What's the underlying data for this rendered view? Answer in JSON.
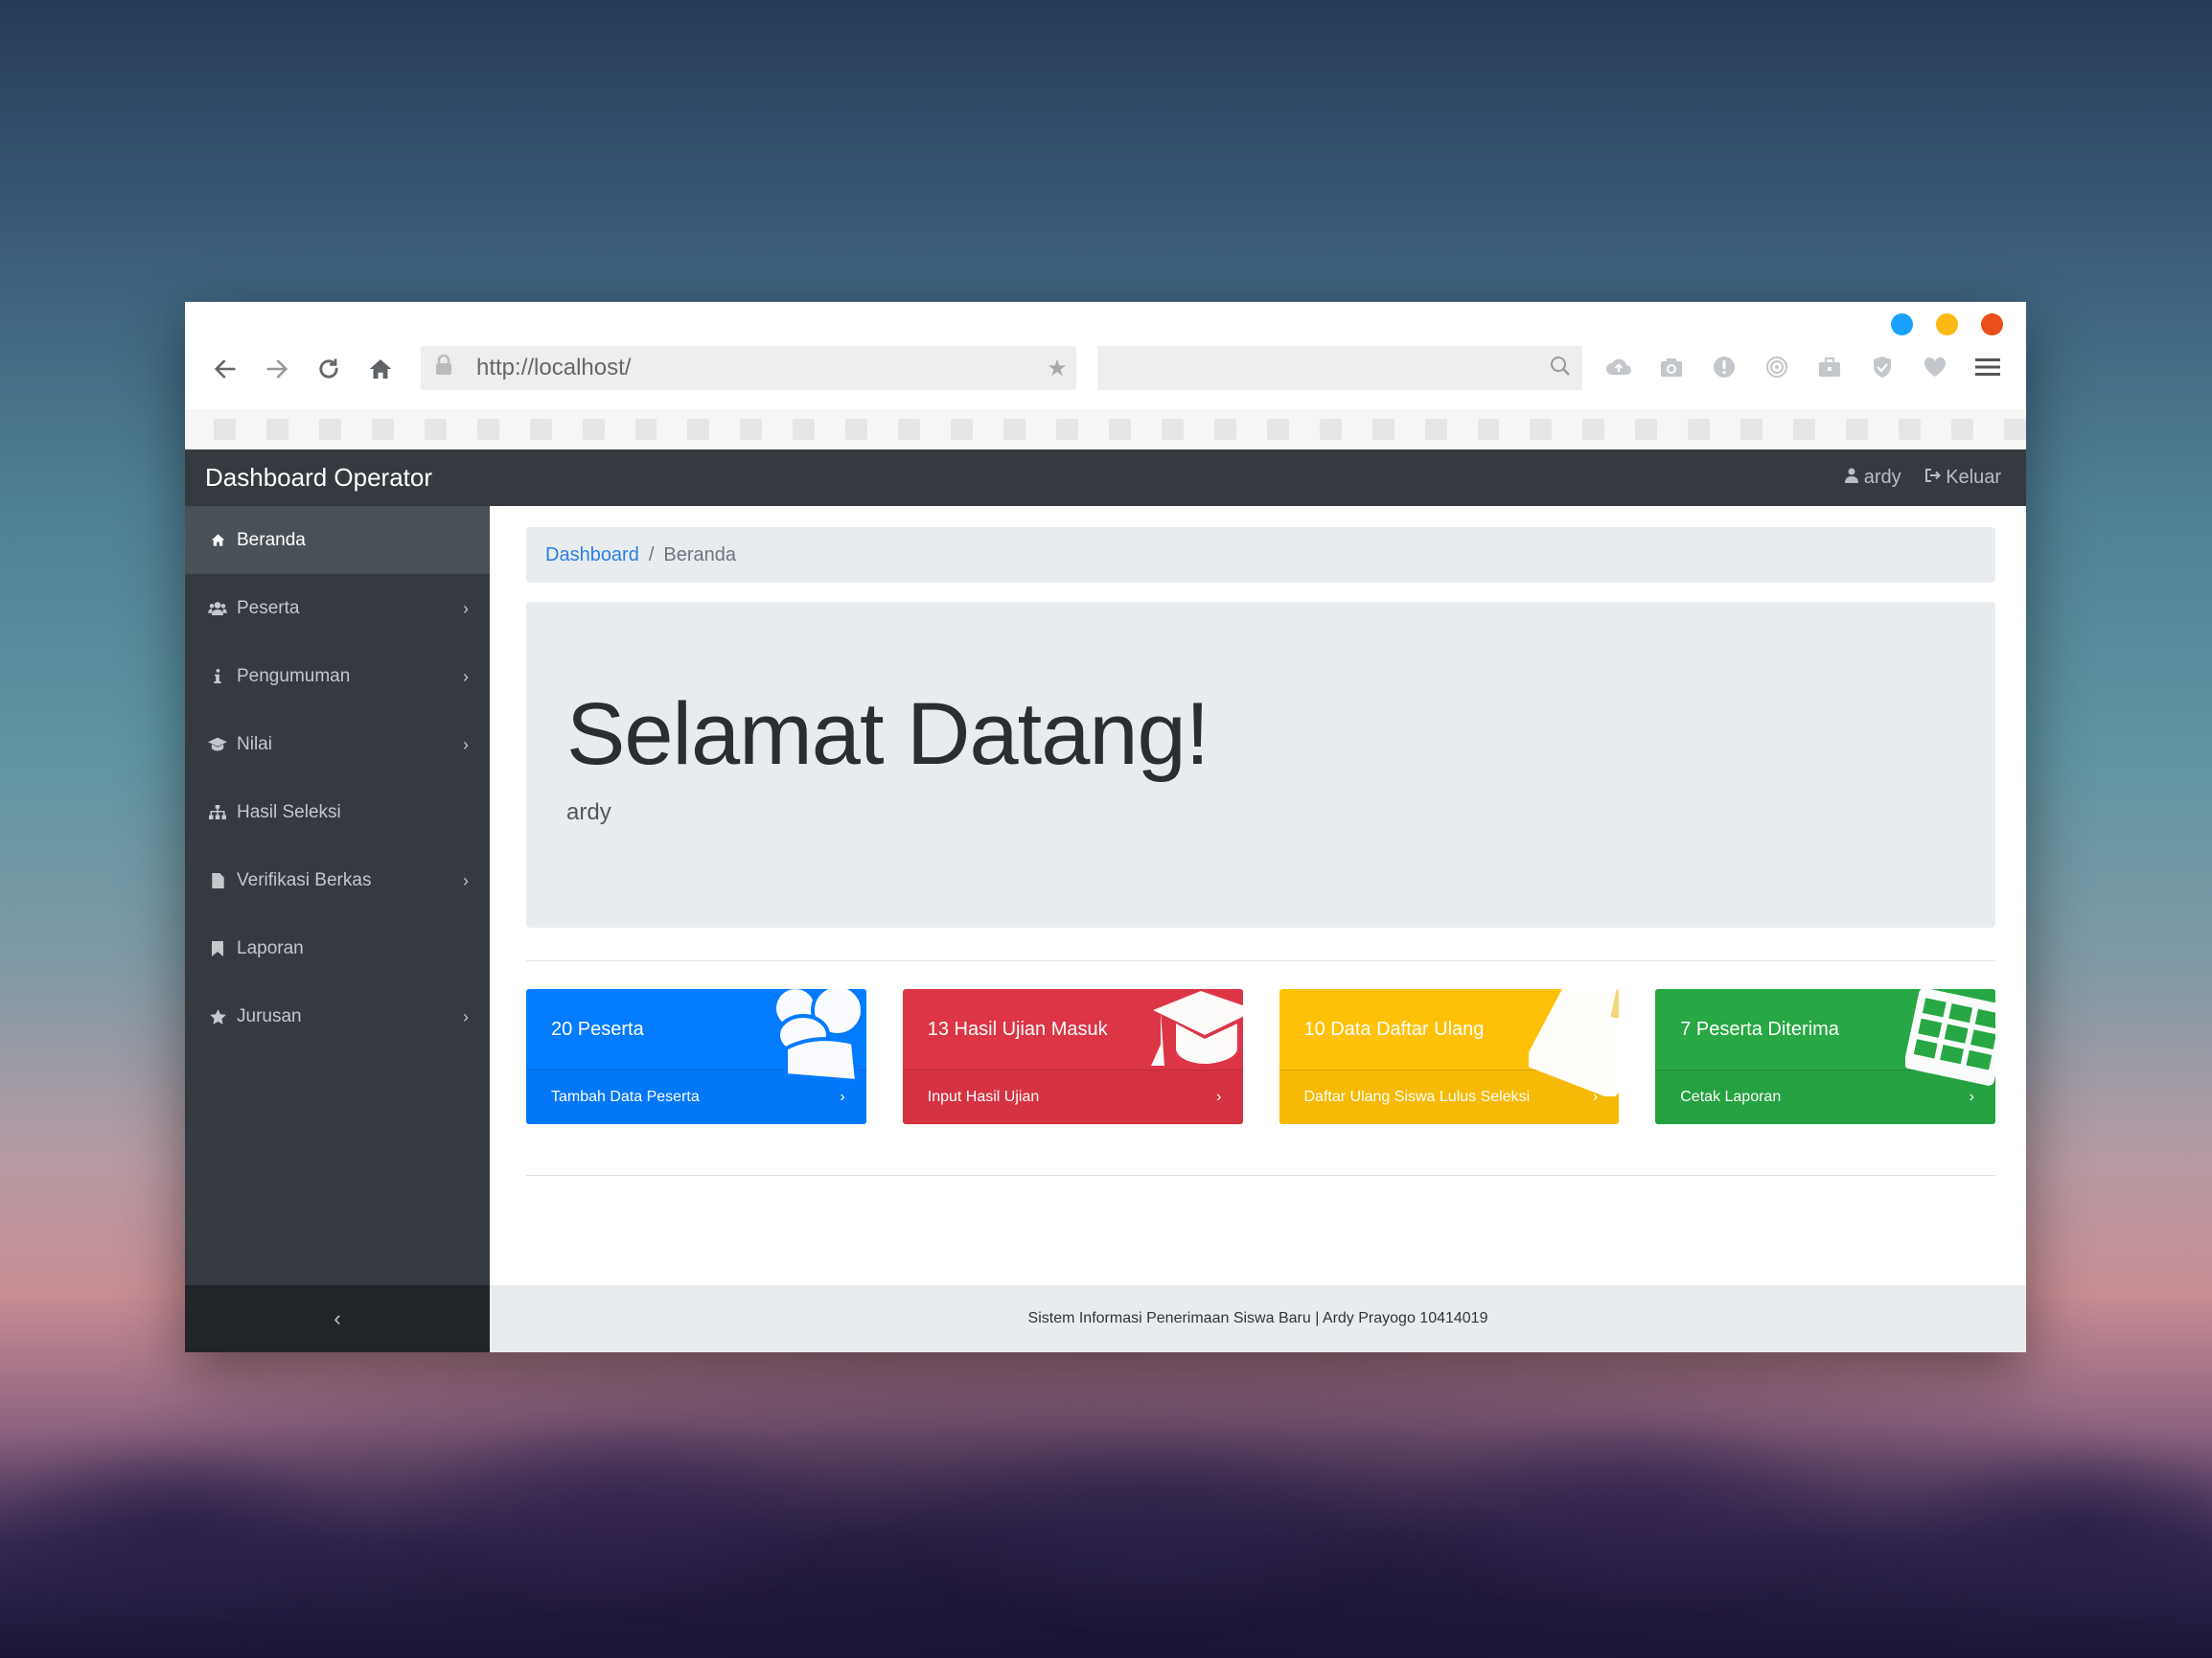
{
  "browser": {
    "url": "http://localhost/",
    "search_placeholder": "",
    "window_dots": [
      "#18a1ff",
      "#fdb813",
      "#ea4e1d"
    ],
    "toolbar_icons": [
      "cloud-upload-icon",
      "camera-icon",
      "alert-icon",
      "fingerprint-icon",
      "briefcase-icon",
      "shield-icon",
      "heart-icon"
    ]
  },
  "app": {
    "brand": "Dashboard Operator",
    "user": "ardy",
    "logout": "Keluar"
  },
  "sidebar": {
    "items": [
      {
        "label": "Beranda",
        "icon": "home-icon",
        "active": true,
        "submenu": false
      },
      {
        "label": "Peserta",
        "icon": "users-icon",
        "active": false,
        "submenu": true
      },
      {
        "label": "Pengumuman",
        "icon": "info-icon",
        "active": false,
        "submenu": true
      },
      {
        "label": "Nilai",
        "icon": "graduation-cap-icon",
        "active": false,
        "submenu": true
      },
      {
        "label": "Hasil Seleksi",
        "icon": "sitemap-icon",
        "active": false,
        "submenu": false
      },
      {
        "label": "Verifikasi Berkas",
        "icon": "file-icon",
        "active": false,
        "submenu": true
      },
      {
        "label": "Laporan",
        "icon": "bookmark-icon",
        "active": false,
        "submenu": false
      },
      {
        "label": "Jurusan",
        "icon": "star-icon",
        "active": false,
        "submenu": true
      }
    ],
    "toggle": "‹"
  },
  "breadcrumb": {
    "root": "Dashboard",
    "current": "Beranda"
  },
  "jumbotron": {
    "title": "Selamat Datang!",
    "subtitle": "ardy"
  },
  "cards": [
    {
      "title": "20 Peserta",
      "action": "Tambah Data Peserta",
      "color": "#037bff",
      "icon": "users-icon"
    },
    {
      "title": "13 Hasil Ujian Masuk",
      "action": "Input Hasil Ujian",
      "color": "#dc3545",
      "icon": "graduation-cap-icon"
    },
    {
      "title": "10 Data Daftar Ulang",
      "action": "Daftar Ulang Siswa Lulus Seleksi",
      "color": "#fec107",
      "icon": "file-icon"
    },
    {
      "title": "7 Peserta Diterima",
      "action": "Cetak Laporan",
      "color": "#28a745",
      "icon": "table-icon"
    }
  ],
  "footer": "Sistem Informasi Penerimaan Siswa Baru | Ardy Prayogo 10414019"
}
